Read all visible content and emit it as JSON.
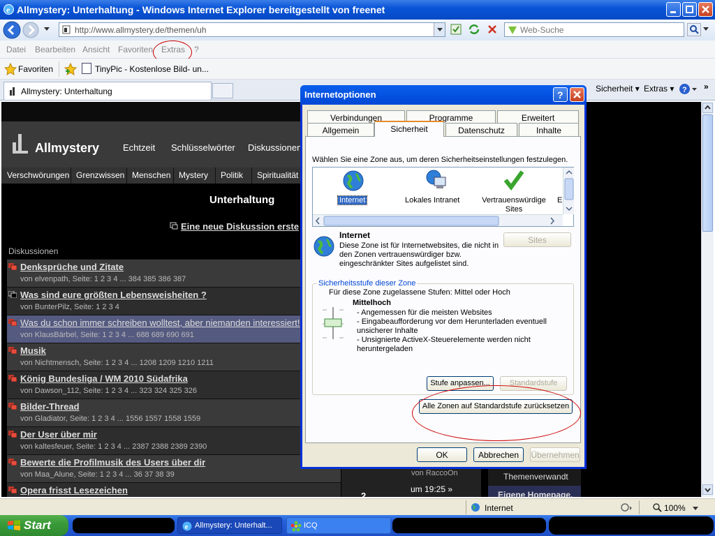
{
  "window": {
    "title": "Allmystery: Unterhaltung - Windows Internet Explorer bereitgestellt von freenet"
  },
  "nav": {
    "address": "http://www.allmystery.de/themen/uh",
    "search_placeholder": "Web-Suche"
  },
  "menu": [
    "Datei",
    "Bearbeiten",
    "Ansicht",
    "Favoriten",
    "Extras",
    "?"
  ],
  "favorites": {
    "label": "Favoriten",
    "link": "TinyPic - Kostenlose Bild- un..."
  },
  "tabs": {
    "active": "Allmystery: Unterhaltung"
  },
  "toolbar_right": {
    "sicherheit": "Sicherheit ▾",
    "extras": "Extras ▾"
  },
  "site": {
    "logo": "Allmystery",
    "header_nav": [
      "Echtzeit",
      "Schlüsselwörter",
      "Diskussionen"
    ],
    "categories": [
      "Verschwörungen",
      "Grenzwissen",
      "Menschen",
      "Mystery",
      "Politik",
      "Spiritualität"
    ],
    "page_title": "Unterhaltung",
    "new_discussion": "Eine neue Diskussion erste",
    "section_label": "Diskussionen",
    "threads": [
      {
        "title": "Denksprüche und Zitate",
        "meta": "von elvenpath, Seite: 1 2 3 4 ... 384 385 386 387"
      },
      {
        "title": "Was sind eure größten Lebensweisheiten ?",
        "meta": "von BunterPilz, Seite: 1 2 3 4"
      },
      {
        "title": "Was du schon immer schreiben wolltest, aber niemanden interessiert!",
        "meta": "von KlausBärbel, Seite: 1 2 3 4 ... 688 689 690 691"
      },
      {
        "title": "Musik",
        "meta": "von Nichtmensch, Seite: 1 2 3 4 ... 1208 1209 1210 1211"
      },
      {
        "title": "König Bundesliga / WM 2010 Südafrika",
        "meta": "von Dawson_112, Seite: 1 2 3 4 ... 323 324 325 326"
      },
      {
        "title": "Bilder-Thread",
        "meta": "von Gladiator, Seite: 1 2 3 4 ... 1556 1557 1558 1559"
      },
      {
        "title": "Der User über mir",
        "meta": "von kaltesfeuer, Seite: 1 2 3 4 ... 2387 2388 2389 2390"
      },
      {
        "title": "Bewerte die Profilmusik des Users über dir",
        "meta": "von Maa_Alune, Seite: 1 2 3 4 ... 36 37 38 39"
      },
      {
        "title": "Opera frisst Lesezeichen",
        "meta": ""
      }
    ],
    "right_col": {
      "row1_author": "von RaccoOn",
      "row2_count": "2",
      "row2_time": "um 19:25 »"
    },
    "side_links": [
      "Themenverwandt",
      "Eigene Homepage."
    ]
  },
  "dialog": {
    "title": "Internetoptionen",
    "tabs_top": [
      "Verbindungen",
      "Programme",
      "Erweitert"
    ],
    "tabs_bottom": [
      "Allgemein",
      "Sicherheit",
      "Datenschutz",
      "Inhalte"
    ],
    "intro": "Wählen Sie eine Zone aus, um deren Sicherheitseinstellungen festzulegen.",
    "zones": [
      "Internet",
      "Lokales Intranet",
      "Vertrauenswürdige Sites",
      "E"
    ],
    "zone_heading": "Internet",
    "zone_desc": [
      "Diese Zone ist für Internetwebsites, die nicht in",
      "den Zonen vertrauenswürdiger bzw.",
      "eingeschränkter Sites aufgelistet sind."
    ],
    "sites_button": "Sites",
    "group_label": "Sicherheitsstufe dieser Zone",
    "allowed": "Für diese Zone zugelassene Stufen: Mittel oder Hoch",
    "level": "Mittelhoch",
    "bullets": [
      "- Angemessen für die meisten Websites",
      "- Eingabeaufforderung vor dem Herunterladen eventuell",
      "unsicherer Inhalte",
      "- Unsignierte ActiveX-Steuerelemente werden nicht",
      "heruntergeladen"
    ],
    "custom_button": "Stufe anpassen...",
    "default_button": "Standardstufe",
    "reset_button": "Alle Zonen auf Standardstufe zurücksetzen",
    "ok": "OK",
    "cancel": "Abbrechen",
    "apply": "Übernehmen"
  },
  "status": {
    "zone": "Internet",
    "zoom": "100%"
  },
  "taskbar": {
    "start": "Start",
    "items": [
      "Allmystery: Unterhalt...",
      "ICQ"
    ]
  },
  "colors": {
    "annotation": "#cc0000",
    "xp_blue": "#0a55d8",
    "dialog_bg": "#ece9d8",
    "start_green": "#3a9a3a"
  }
}
